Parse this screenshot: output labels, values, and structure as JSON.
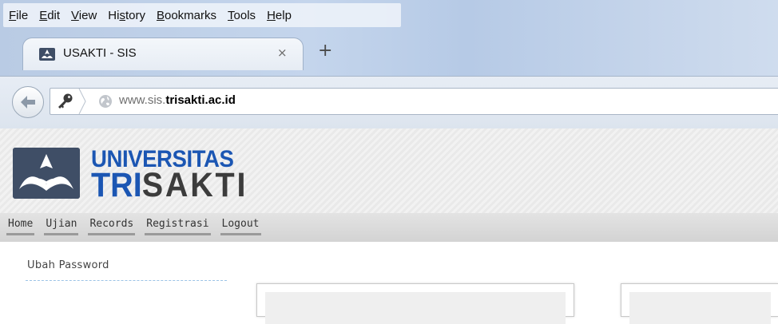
{
  "menubar": {
    "items": [
      {
        "label": "File",
        "accel": "F",
        "rest": "ile"
      },
      {
        "label": "Edit",
        "accel": "E",
        "rest": "dit"
      },
      {
        "label": "View",
        "accel": "V",
        "rest": "iew"
      },
      {
        "label": "History",
        "pre": "Hi",
        "accel": "s",
        "rest": "tory"
      },
      {
        "label": "Bookmarks",
        "accel": "B",
        "rest": "ookmarks"
      },
      {
        "label": "Tools",
        "accel": "T",
        "rest": "ools"
      },
      {
        "label": "Help",
        "accel": "H",
        "rest": "elp"
      }
    ]
  },
  "tab": {
    "title": "USAKTI - SIS",
    "close_glyph": "×",
    "new_tab_glyph": "+"
  },
  "urlbar": {
    "prefix": "www.sis.",
    "host": "trisakti.ac.id"
  },
  "site": {
    "logo_line1": "UNIVERSITAS",
    "logo_line2_a": "TRI",
    "logo_line2_b": "SAKTI",
    "nav": [
      "Home",
      "Ujian",
      "Records",
      "Registrasi",
      "Logout"
    ],
    "sidebar_link": "Ubah Password"
  },
  "colors": {
    "brand_blue": "#1b56b3",
    "brand_dark": "#3c3c3c"
  },
  "icons": {
    "back": "back-arrow-icon",
    "identity": "key-icon",
    "globe": "globe-icon",
    "favicon": "trisakti-logo-icon"
  }
}
